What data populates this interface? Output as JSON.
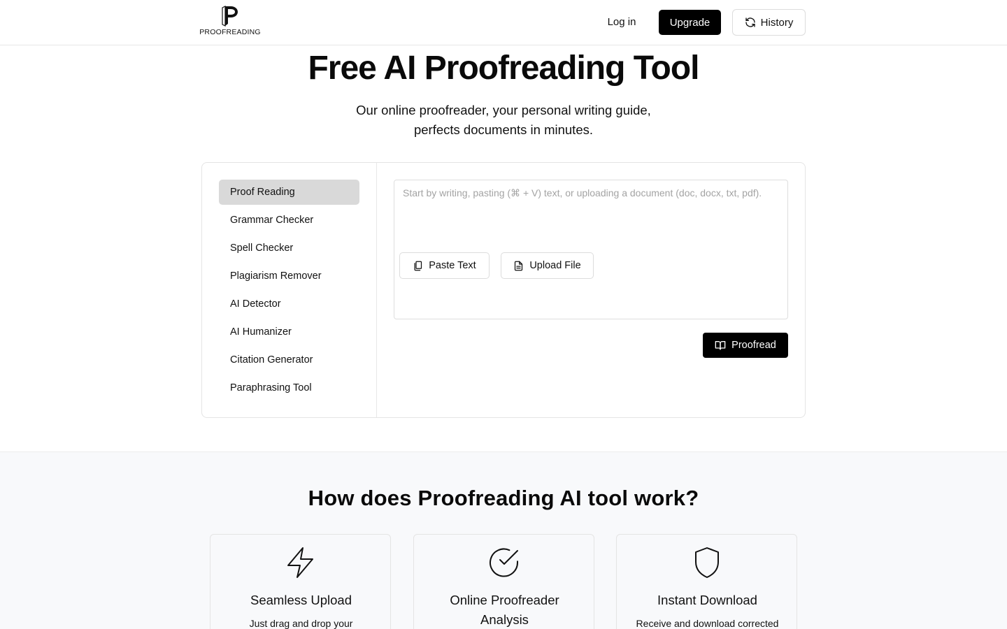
{
  "header": {
    "logo_text": "PROOFREADING",
    "login_label": "Log in",
    "upgrade_label": "Upgrade",
    "history_label": "History"
  },
  "hero": {
    "title": "Free AI Proofreading Tool",
    "subtitle_line1": "Our online proofreader, your personal writing guide,",
    "subtitle_line2": "perfects documents in minutes."
  },
  "tools": {
    "items": [
      {
        "label": "Proof Reading",
        "active": true
      },
      {
        "label": "Grammar Checker",
        "active": false
      },
      {
        "label": "Spell Checker",
        "active": false
      },
      {
        "label": "Plagiarism Remover",
        "active": false
      },
      {
        "label": "AI Detector",
        "active": false
      },
      {
        "label": "AI Humanizer",
        "active": false
      },
      {
        "label": "Citation Generator",
        "active": false
      },
      {
        "label": "Paraphrasing Tool",
        "active": false
      }
    ]
  },
  "editor": {
    "value": "",
    "placeholder": "Start by writing, pasting (⌘ + V) text, or uploading a document (doc, docx, txt, pdf).",
    "paste_label": "Paste Text",
    "upload_label": "Upload File",
    "proofread_label": "Proofread"
  },
  "how": {
    "title": "How does Proofreading AI tool work?",
    "features": [
      {
        "icon": "lightning-icon",
        "title": "Seamless Upload",
        "desc": "Just drag and drop your"
      },
      {
        "icon": "check-circle-icon",
        "title": "Online Proofreader Analysis",
        "desc": ""
      },
      {
        "icon": "shield-icon",
        "title": "Instant Download",
        "desc": "Receive and download corrected"
      }
    ]
  },
  "colors": {
    "primary": "#000000",
    "border": "#e4e4e4",
    "active_item_bg": "#d9d9d9",
    "section_bg": "#f8f9fb",
    "placeholder": "#a3a3a3"
  }
}
